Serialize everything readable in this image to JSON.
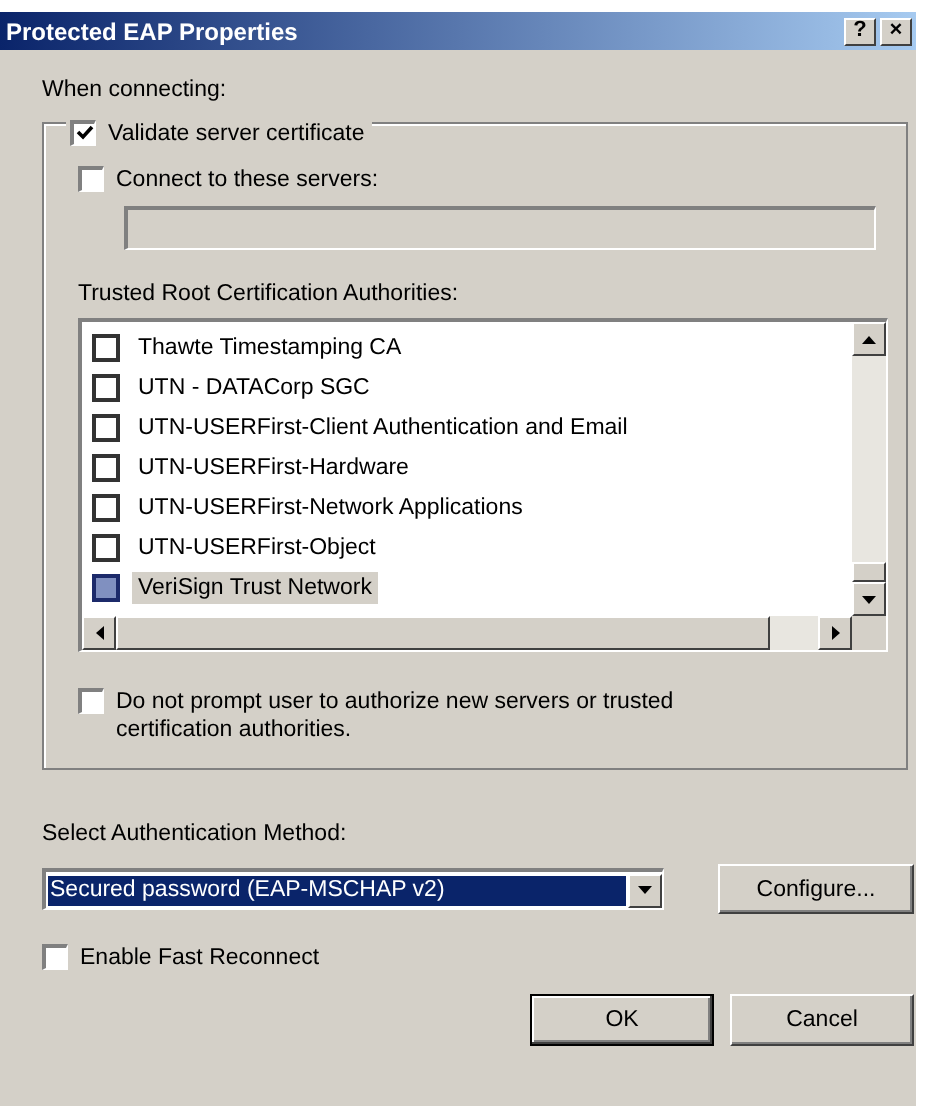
{
  "window": {
    "title": "Protected EAP Properties",
    "help_button": "?",
    "close_button": "×"
  },
  "when_connecting": "When connecting:",
  "validate_server_certificate": {
    "label": "Validate server certificate",
    "checked": true
  },
  "connect_to_servers": {
    "label": "Connect to these servers:",
    "checked": false
  },
  "trusted_root_label": "Trusted Root Certification Authorities:",
  "certificates": [
    {
      "name": "Thawte Timestamping CA",
      "checked": false,
      "selected": false
    },
    {
      "name": "UTN - DATACorp SGC",
      "checked": false,
      "selected": false
    },
    {
      "name": "UTN-USERFirst-Client Authentication and Email",
      "checked": false,
      "selected": false
    },
    {
      "name": "UTN-USERFirst-Hardware",
      "checked": false,
      "selected": false
    },
    {
      "name": "UTN-USERFirst-Network Applications",
      "checked": false,
      "selected": false
    },
    {
      "name": "UTN-USERFirst-Object",
      "checked": false,
      "selected": false
    },
    {
      "name": "VeriSign Trust Network",
      "checked": false,
      "selected": true
    }
  ],
  "do_not_prompt": {
    "label": "Do not prompt user to authorize new servers or trusted certification authorities.",
    "checked": false
  },
  "auth_method_label": "Select Authentication Method:",
  "auth_method": {
    "value": "Secured password (EAP-MSCHAP v2)"
  },
  "configure_button": "Configure...",
  "enable_fast_reconnect": {
    "label": "Enable Fast Reconnect",
    "checked": false
  },
  "buttons": [
    "OK",
    "Cancel"
  ]
}
